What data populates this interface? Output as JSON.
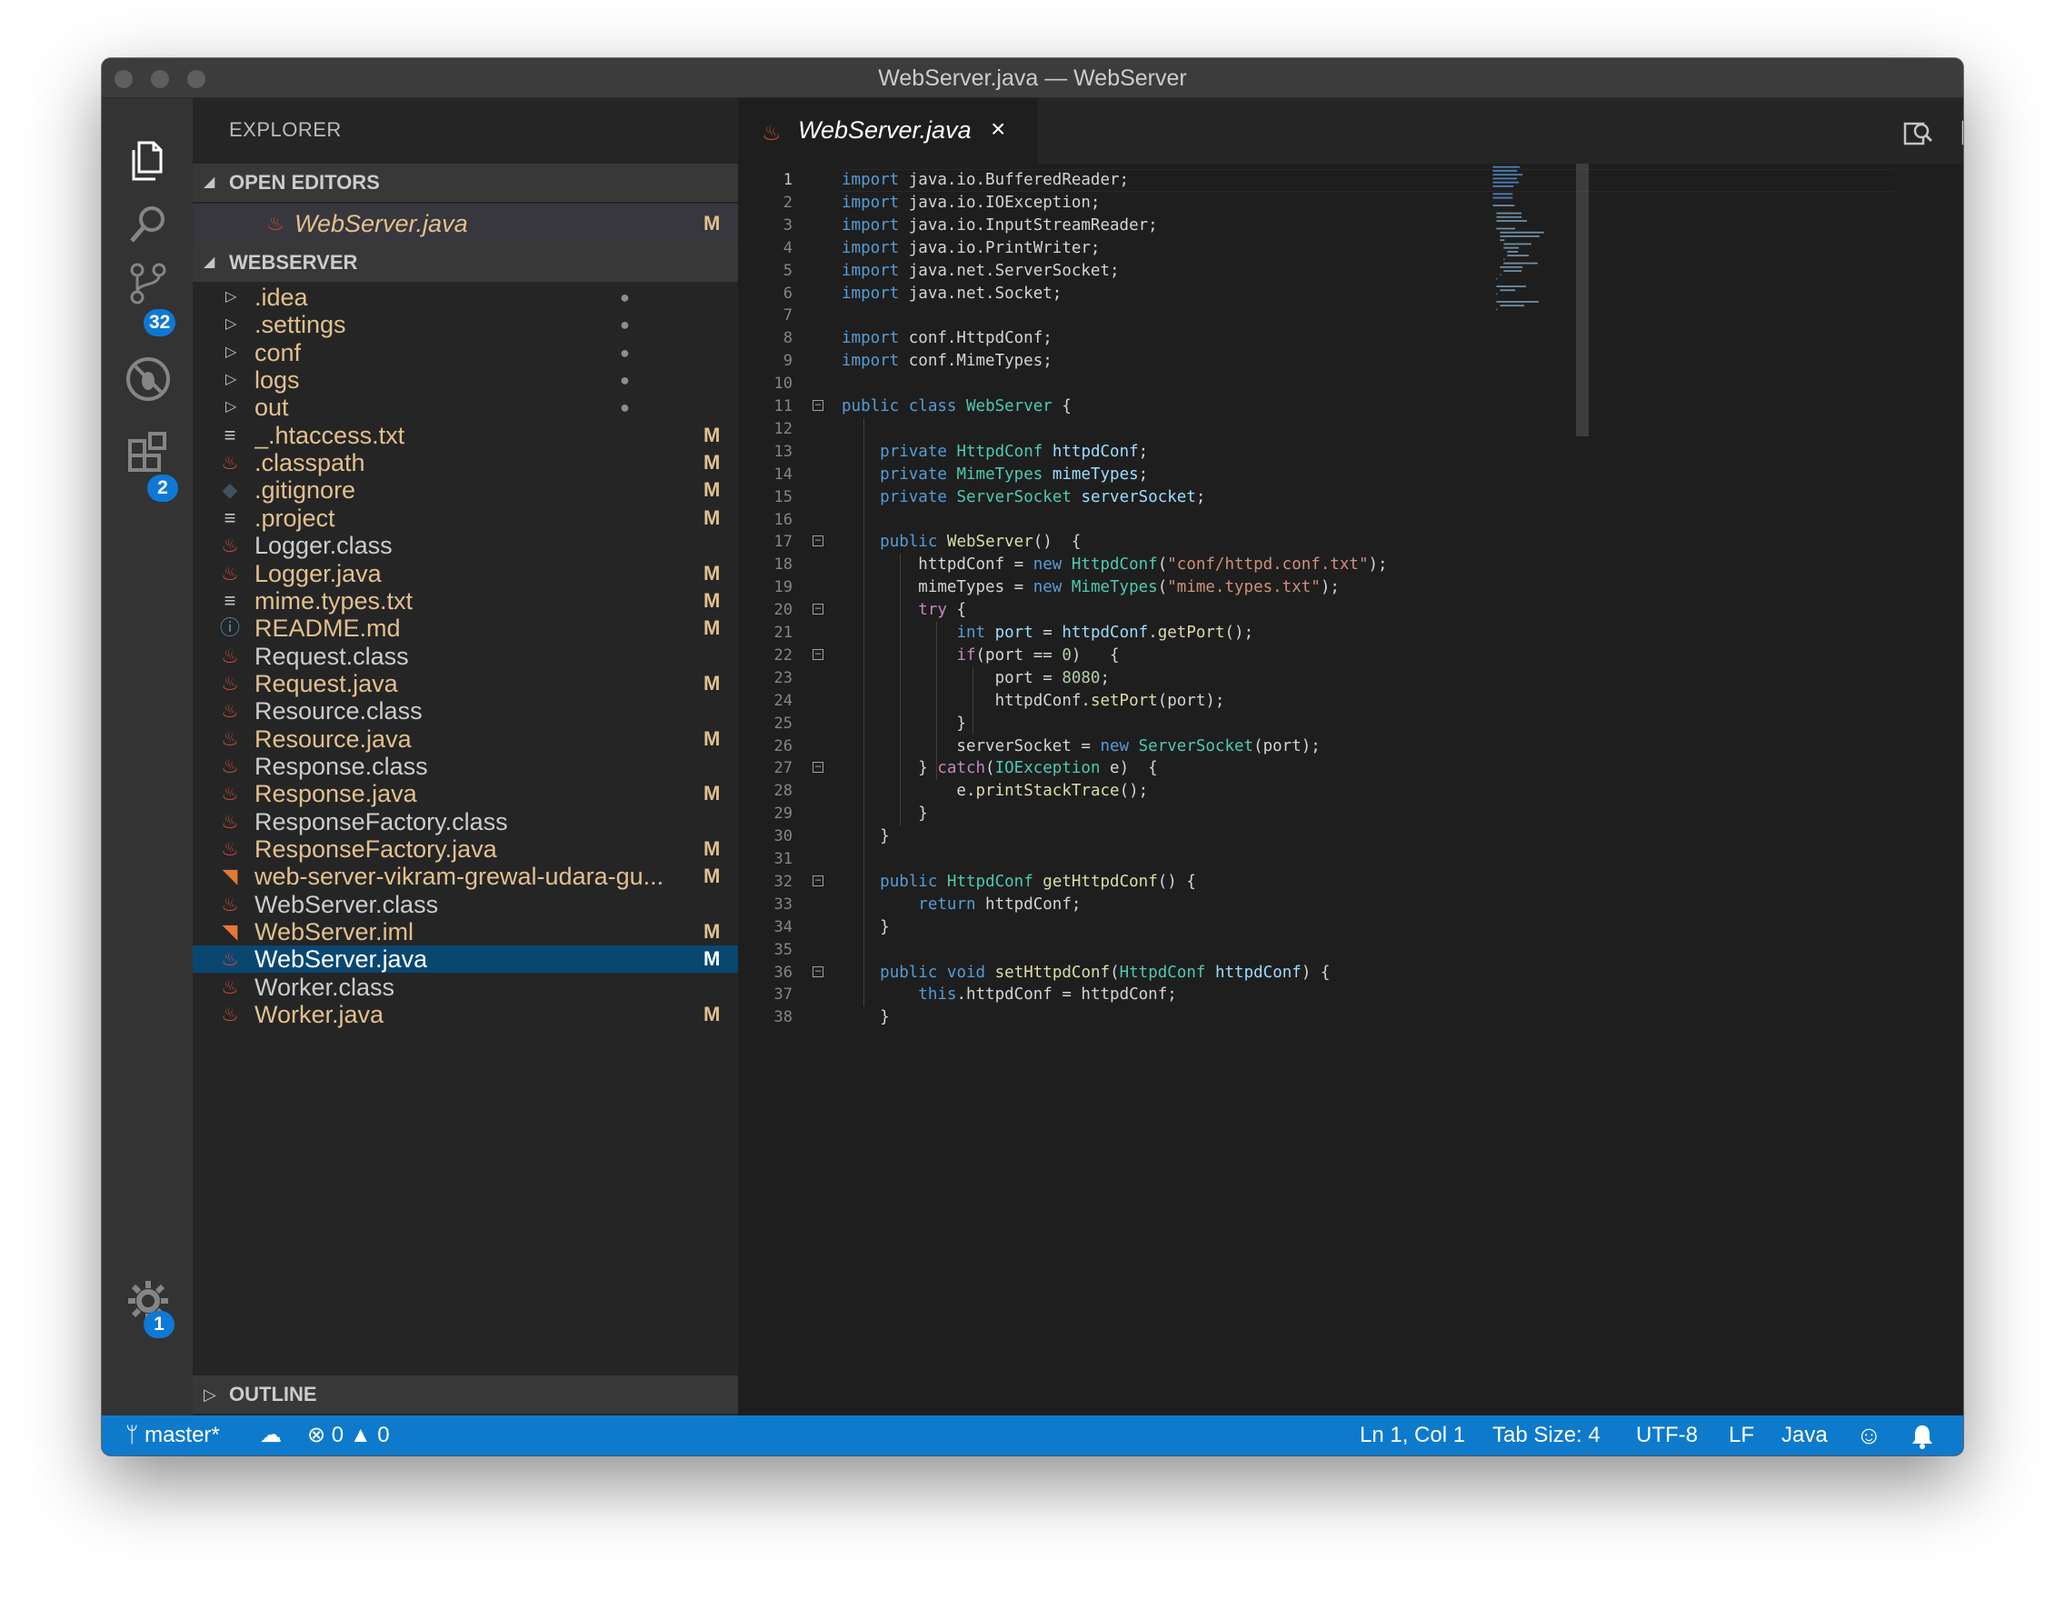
{
  "window": {
    "title": "WebServer.java — WebServer"
  },
  "activity_bar": {
    "scm_badge": "32",
    "extensions_badge": "2",
    "settings_badge": "1"
  },
  "sidebar": {
    "title": "EXPLORER",
    "open_editors_label": "OPEN EDITORS",
    "open_editors": [
      {
        "name": "WebServer.java",
        "status": "M"
      }
    ],
    "folder_label": "WEBSERVER",
    "outline_label": "OUTLINE",
    "files": [
      {
        "name": ".idea",
        "kind": "folder",
        "status": ""
      },
      {
        "name": ".settings",
        "kind": "folder",
        "status": ""
      },
      {
        "name": "conf",
        "kind": "folder",
        "status": ""
      },
      {
        "name": "logs",
        "kind": "folder",
        "status": ""
      },
      {
        "name": "out",
        "kind": "folder",
        "status": ""
      },
      {
        "name": "_.htaccess.txt",
        "kind": "text",
        "status": "M"
      },
      {
        "name": ".classpath",
        "kind": "java",
        "status": "M"
      },
      {
        "name": ".gitignore",
        "kind": "git",
        "status": "M"
      },
      {
        "name": ".project",
        "kind": "text",
        "status": "M"
      },
      {
        "name": "Logger.class",
        "kind": "java",
        "status": ""
      },
      {
        "name": "Logger.java",
        "kind": "java",
        "status": "M"
      },
      {
        "name": "mime.types.txt",
        "kind": "text",
        "status": "M"
      },
      {
        "name": "README.md",
        "kind": "info",
        "status": "M"
      },
      {
        "name": "Request.class",
        "kind": "java",
        "status": ""
      },
      {
        "name": "Request.java",
        "kind": "java",
        "status": "M"
      },
      {
        "name": "Resource.class",
        "kind": "java",
        "status": ""
      },
      {
        "name": "Resource.java",
        "kind": "java",
        "status": "M"
      },
      {
        "name": "Response.class",
        "kind": "java",
        "status": ""
      },
      {
        "name": "Response.java",
        "kind": "java",
        "status": "M"
      },
      {
        "name": "ResponseFactory.class",
        "kind": "java",
        "status": ""
      },
      {
        "name": "ResponseFactory.java",
        "kind": "java",
        "status": "M"
      },
      {
        "name": "web-server-vikram-grewal-udara-gu...",
        "kind": "rss",
        "status": "M"
      },
      {
        "name": "WebServer.class",
        "kind": "java",
        "status": ""
      },
      {
        "name": "WebServer.iml",
        "kind": "rss",
        "status": "M"
      },
      {
        "name": "WebServer.java",
        "kind": "java",
        "status": "M",
        "selected": true
      },
      {
        "name": "Worker.class",
        "kind": "java",
        "status": ""
      },
      {
        "name": "Worker.java",
        "kind": "java",
        "status": "M"
      }
    ]
  },
  "editor": {
    "tab_label": "WebServer.java",
    "tab_close": "×",
    "lines": [
      "import java.io.BufferedReader;",
      "import java.io.IOException;",
      "import java.io.InputStreamReader;",
      "import java.io.PrintWriter;",
      "import java.net.ServerSocket;",
      "import java.net.Socket;",
      "",
      "import conf.HttpdConf;",
      "import conf.MimeTypes;",
      "",
      "public class WebServer {",
      "",
      "    private HttpdConf httpdConf;",
      "    private MimeTypes mimeTypes;",
      "    private ServerSocket serverSocket;",
      "",
      "    public WebServer()  {",
      "        httpdConf = new HttpdConf(\"conf/httpd.conf.txt\");",
      "        mimeTypes = new MimeTypes(\"mime.types.txt\");",
      "        try {",
      "            int port = httpdConf.getPort();",
      "            if(port == 0)   {",
      "                port = 8080;",
      "                httpdConf.setPort(port);",
      "            }",
      "            serverSocket = new ServerSocket(port);",
      "        } catch(IOException e)  {",
      "            e.printStackTrace();",
      "        }",
      "    }",
      "",
      "    public HttpdConf getHttpdConf() {",
      "        return httpdConf;",
      "    }",
      "",
      "    public void setHttpdConf(HttpdConf httpdConf) {",
      "        this.httpdConf = httpdConf;",
      "    }"
    ],
    "fold_lines": [
      11,
      17,
      20,
      22,
      27,
      32,
      36
    ]
  },
  "status_bar": {
    "branch": "master*",
    "errors": "0",
    "warnings": "0",
    "position": "Ln 1, Col 1",
    "tab_size": "Tab Size: 4",
    "encoding": "UTF-8",
    "eol": "LF",
    "language": "Java"
  },
  "colors": {
    "accent": "#0e7acc",
    "modified": "#e2c08d",
    "selection": "#094771"
  }
}
